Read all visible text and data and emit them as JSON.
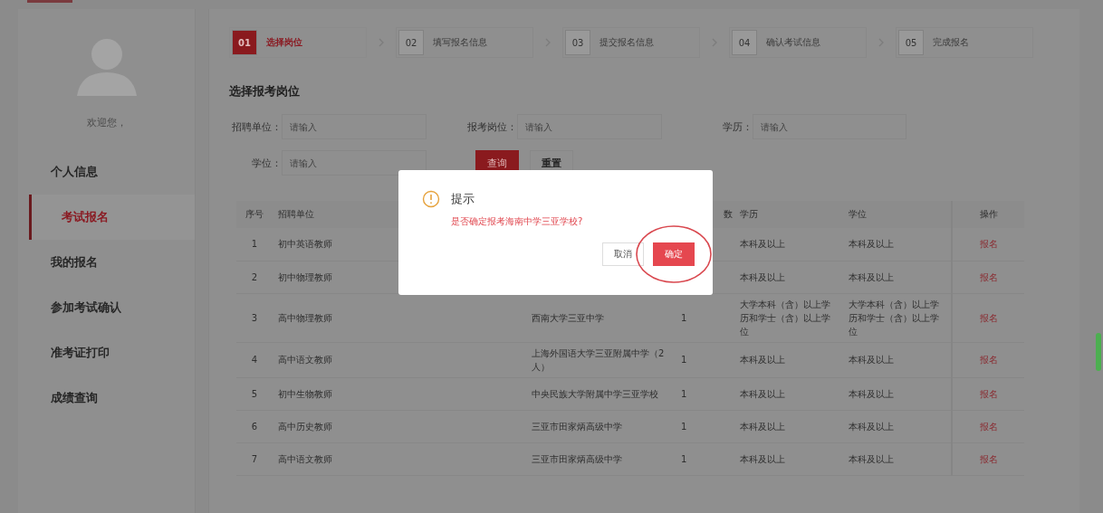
{
  "sidebar": {
    "welcome": "欢迎您，",
    "nav_items": [
      {
        "label": "个人信息",
        "selected": false
      },
      {
        "label": "考试报名",
        "selected": true
      },
      {
        "label": "我的报名",
        "selected": false
      },
      {
        "label": "参加考试确认",
        "selected": false
      },
      {
        "label": "准考证打印",
        "selected": false
      },
      {
        "label": "成绩查询",
        "selected": false
      }
    ]
  },
  "steps": [
    {
      "number": "01",
      "label": "选择岗位",
      "selected": true
    },
    {
      "number": "02",
      "label": "填写报名信息",
      "selected": false
    },
    {
      "number": "03",
      "label": "提交报名信息",
      "selected": false
    },
    {
      "number": "04",
      "label": "确认考试信息",
      "selected": false
    },
    {
      "number": "05",
      "label": "完成报名",
      "selected": false
    }
  ],
  "section_title": "选择报考岗位",
  "filters": [
    {
      "label": "招聘单位：",
      "placeholder": "请输入"
    },
    {
      "label": "报考岗位：",
      "placeholder": "请输入"
    },
    {
      "label": "学历：",
      "placeholder": "请输入"
    },
    {
      "label": "学位：",
      "placeholder": "请输入"
    }
  ],
  "buttons": [
    {
      "label": "查询",
      "kind": "primary"
    },
    {
      "label": "重置",
      "kind": "plain"
    }
  ],
  "table": {
    "columns": [
      "序号",
      "招聘单位",
      "",
      "数",
      "学历",
      "学位",
      "操作"
    ],
    "rows": [
      {
        "no": "1",
        "post": "初中英语教师",
        "education": "本科及以上",
        "degree": "本科及以上",
        "action": "报名"
      },
      {
        "no": "2",
        "post": "初中物理教师",
        "education": "本科及以上",
        "degree": "本科及以上",
        "action": "报名"
      },
      {
        "no": "3",
        "post": "高中物理教师",
        "school": "西南大学三亚中学",
        "count": "1",
        "education": "大学本科（含）以上学历和学士（含）以上学位",
        "degree": "大学本科（含）以上学历和学士（含）以上学位",
        "action": "报名"
      },
      {
        "no": "4",
        "post": "高中语文教师",
        "school": "上海外国语大学三亚附属中学（2人）",
        "count": "1",
        "education": "本科及以上",
        "degree": "本科及以上",
        "action": "报名"
      },
      {
        "no": "5",
        "post": "初中生物教师",
        "school": "中央民族大学附属中学三亚学校",
        "count": "1",
        "education": "本科及以上",
        "degree": "本科及以上",
        "action": "报名"
      },
      {
        "no": "6",
        "post": "高中历史教师",
        "school": "三亚市田家炳高级中学",
        "count": "1",
        "education": "本科及以上",
        "degree": "本科及以上",
        "action": "报名"
      },
      {
        "no": "7",
        "post": "高中语文教师",
        "school": "三亚市田家炳高级中学",
        "count": "1",
        "education": "本科及以上",
        "degree": "本科及以上",
        "action": "报名"
      }
    ]
  },
  "dialog": {
    "title": "提示",
    "message": "是否确定报考海南中学三亚学校?",
    "buttons": [
      {
        "label": "取消",
        "kind": "plain"
      },
      {
        "label": "确定",
        "kind": "primary",
        "highlighted": true
      }
    ]
  }
}
